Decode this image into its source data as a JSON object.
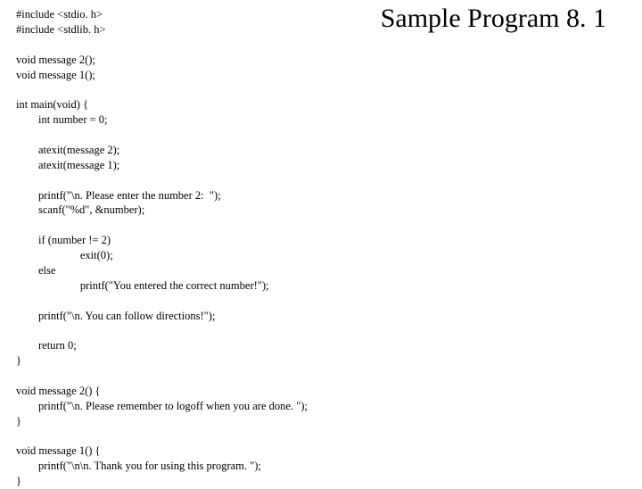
{
  "title": "Sample Program 8. 1",
  "code_lines": [
    "#include <stdio. h>",
    "#include <stdlib. h>",
    "",
    "void message 2();",
    "void message 1();",
    "",
    "int main(void) {",
    "        int number = 0;",
    "",
    "        atexit(message 2);",
    "        atexit(message 1);",
    "",
    "        printf(\"\\n. Please enter the number 2:  \");",
    "        scanf(\"%d\", &number);",
    "",
    "        if (number != 2)",
    "                       exit(0);",
    "        else",
    "                       printf(\"You entered the correct number!\");",
    "",
    "        printf(\"\\n. You can follow directions!\");",
    "",
    "        return 0;",
    "}",
    "",
    "void message 2() {",
    "        printf(\"\\n. Please remember to logoff when you are done. \");",
    "}",
    "",
    "void message 1() {",
    "        printf(\"\\n\\n. Thank you for using this program. \");",
    "}"
  ]
}
